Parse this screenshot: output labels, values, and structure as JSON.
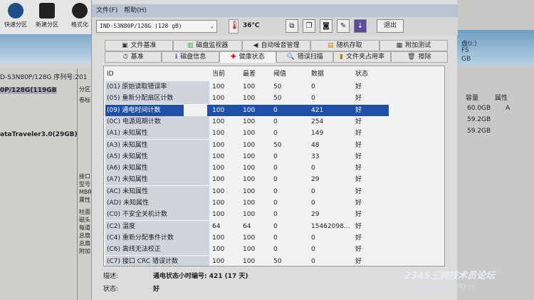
{
  "background_app": {
    "toolbar": [
      {
        "label": "快速分区"
      },
      {
        "label": "新建分区"
      },
      {
        "label": "格式化"
      }
    ],
    "disk_header": "D-S3N80P/128G  序列号:201",
    "disk_tree": [
      "0P/128G(119GB)",
      "ataTraveler3.0(29GB)"
    ],
    "side_labels": [
      "分区",
      "卷标",
      "接口",
      "型号",
      "MBR",
      "属性",
      "柱面",
      "磁头",
      "每道",
      "总扇",
      "总扇",
      "附加"
    ],
    "right_panel": {
      "col_capacity": "容量",
      "col_attr": "属性",
      "rows": [
        {
          "cap": "60.0GB",
          "attr": "A"
        },
        {
          "cap": "59.2GB",
          "attr": ""
        },
        {
          "cap": "59.2GB",
          "attr": ""
        }
      ],
      "partition_label": "盘(I:)",
      "fs": "FS",
      "size": "GB"
    }
  },
  "dialog": {
    "menu": [
      "文件(F)",
      "帮助(H)"
    ],
    "disk_select": "IND-S3N80P/128G (128 gB)",
    "temperature": "36℃",
    "exit_label": "退出",
    "tabs_row1": [
      "文件基准",
      "磁盘监视器",
      "自动噪音管理",
      "随机存取",
      "附加测试"
    ],
    "tabs_row2": [
      "基准",
      "磁盘信息",
      "健康状态",
      "错误扫描",
      "文件夹占用率",
      "擦除"
    ],
    "active_tab": "健康状态",
    "columns": [
      "ID",
      "当前",
      "最差",
      "阈值",
      "数据",
      "状态"
    ],
    "rows": [
      [
        "(01) 原始读取错误率",
        "100",
        "100",
        "50",
        "0",
        "好"
      ],
      [
        "(05) 重新分配扇区计数",
        "100",
        "100",
        "50",
        "0",
        "好"
      ],
      [
        "(09) 通电时间计数",
        "100",
        "100",
        "0",
        "421",
        "好"
      ],
      [
        "(0C) 电源周期计数",
        "100",
        "100",
        "0",
        "254",
        "好"
      ],
      [
        "(A1) 未知属性",
        "100",
        "100",
        "0",
        "149",
        "好"
      ],
      [
        "(A3) 未知属性",
        "100",
        "100",
        "50",
        "48",
        "好"
      ],
      [
        "(A5) 未知属性",
        "100",
        "100",
        "0",
        "33",
        "好"
      ],
      [
        "(A6) 未知属性",
        "100",
        "100",
        "0",
        "0",
        "好"
      ],
      [
        "(A7) 未知属性",
        "100",
        "100",
        "0",
        "29",
        "好"
      ],
      [
        "(AC) 未知属性",
        "100",
        "100",
        "0",
        "0",
        "好"
      ],
      [
        "(AD) 未知属性",
        "100",
        "100",
        "0",
        "0",
        "好"
      ],
      [
        "(C0) 不安全关机计数",
        "100",
        "100",
        "0",
        "29",
        "好"
      ],
      [
        "(C2) 温度",
        "64",
        "64",
        "0",
        "15462098...",
        "好"
      ],
      [
        "(C4) 重新分配事件计数",
        "100",
        "100",
        "0",
        "0",
        "好"
      ],
      [
        "(C6) 离线无法校正",
        "100",
        "100",
        "0",
        "0",
        "好"
      ],
      [
        "(C7) 接口 CRC 错误计数",
        "100",
        "100",
        "50",
        "0",
        "好"
      ]
    ],
    "selected_row": 2,
    "description_label": "描述:",
    "description": "通电状态小时编号: 421 (17 天)",
    "status_label": "状态:",
    "status": "好"
  },
  "watermark": {
    "title": "2345王牌技术员论坛",
    "url": "wangpai.2345.cn"
  }
}
